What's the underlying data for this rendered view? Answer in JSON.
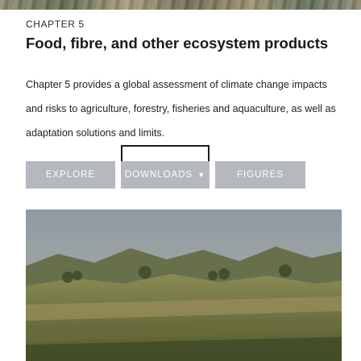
{
  "chapter": {
    "label": "CHAPTER 5",
    "title": "Food, fibre, and other ecosystem products",
    "description": "Chapter 5 provides a global assessment of climate change impacts and risks to agriculture, forestry, fisheries and aquaculture, as well as adaptation solutions and limits."
  },
  "buttons": {
    "explore": "EXPLORE",
    "downloads": "DOWNLOADS",
    "figures": "FIGURES"
  },
  "icons": {
    "downloads_caret": "chevron-down-icon"
  },
  "colors": {
    "button_bg": "#b5b8be",
    "button_text": "#ffffff",
    "focus_outline": "#1c1c1c"
  }
}
